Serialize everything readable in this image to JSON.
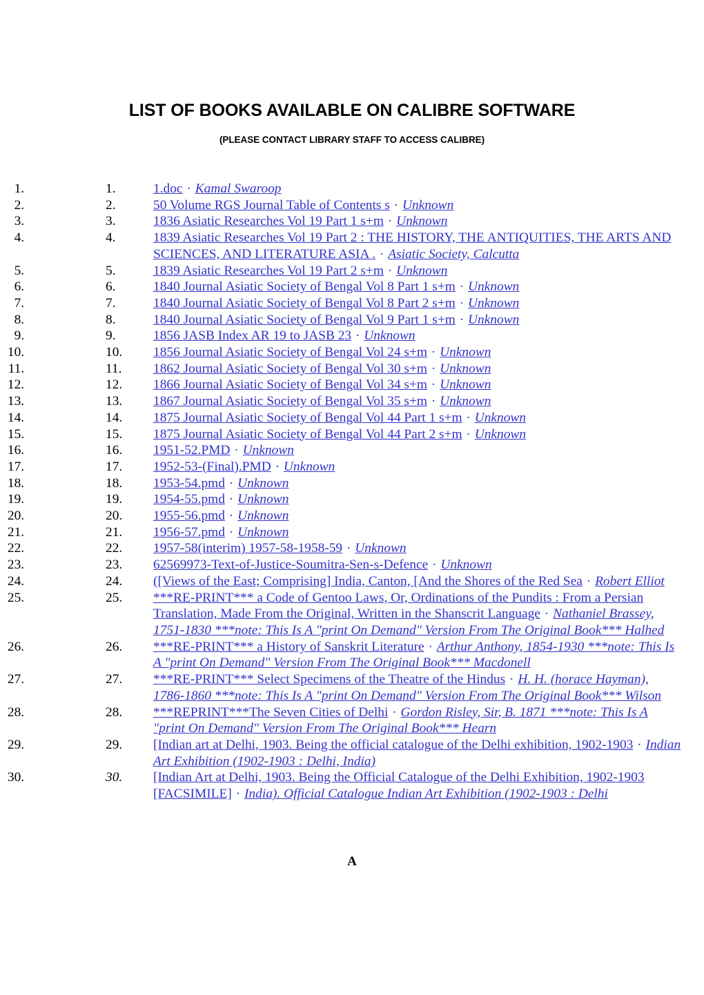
{
  "document": {
    "title": "LIST OF BOOKS AVAILABLE ON CALIBRE SOFTWARE",
    "subtitle": "(PLEASE CONTACT LIBRARY STAFF TO ACCESS CALIBRE)",
    "footer": "A",
    "link_color": "#3333CC",
    "text_color": "#000000",
    "background_color": "#FFFFFF",
    "separator": "·"
  },
  "books": [
    {
      "number": "1.",
      "number_italic": false,
      "title": "1.doc",
      "author": "Kamal Swaroop"
    },
    {
      "number": "2.",
      "number_italic": false,
      "title": "50 Volume RGS Journal Table of Contents s",
      "author": "Unknown"
    },
    {
      "number": "3.",
      "number_italic": false,
      "title": "1836 Asiatic Researches Vol 19 Part 1 s+m",
      "author": "Unknown"
    },
    {
      "number": "4.",
      "number_italic": false,
      "title": "1839 Asiatic Researches Vol 19 Part 2 : THE HISTORY, THE ANTIQUITIES, THE ARTS AND SCIENCES, AND LITERATURE ASIA .",
      "author": "Asiatic Society, Calcutta"
    },
    {
      "number": "5.",
      "number_italic": false,
      "title": "1839 Asiatic Researches Vol 19 Part 2 s+m",
      "author": "Unknown"
    },
    {
      "number": "6.",
      "number_italic": false,
      "title": "1840 Journal Asiatic Society of Bengal Vol 8 Part 1 s+m",
      "author": "Unknown"
    },
    {
      "number": "7.",
      "number_italic": false,
      "title": "1840 Journal Asiatic Society of Bengal Vol 8 Part 2 s+m",
      "author": "Unknown"
    },
    {
      "number": "8.",
      "number_italic": false,
      "title": "1840 Journal Asiatic Society of Bengal Vol 9 Part 1 s+m",
      "author": "Unknown"
    },
    {
      "number": "9.",
      "number_italic": false,
      "title": "1856 JASB Index AR 19 to JASB 23",
      "author": "Unknown"
    },
    {
      "number": "10.",
      "number_italic": false,
      "title": "1856 Journal Asiatic Society of Bengal Vol 24 s+m",
      "author": "Unknown"
    },
    {
      "number": "11.",
      "number_italic": false,
      "title": "1862 Journal Asiatic Society of Bengal Vol 30 s+m",
      "author": "Unknown"
    },
    {
      "number": "12.",
      "number_italic": false,
      "title": "1866 Journal Asiatic Society of Bengal Vol 34 s+m",
      "author": "Unknown"
    },
    {
      "number": "13.",
      "number_italic": false,
      "title": "1867 Journal Asiatic Society of Bengal Vol 35 s+m",
      "author": "Unknown"
    },
    {
      "number": "14.",
      "number_italic": false,
      "title": "1875 Journal Asiatic Society of Bengal Vol 44 Part 1 s+m",
      "author": "Unknown"
    },
    {
      "number": "15.",
      "number_italic": false,
      "title": "1875 Journal Asiatic Society of Bengal Vol 44 Part 2 s+m",
      "author": "Unknown"
    },
    {
      "number": "16.",
      "number_italic": false,
      "title": "1951-52.PMD",
      "author": "Unknown"
    },
    {
      "number": "17.",
      "number_italic": false,
      "title": "1952-53-(Final).PMD",
      "author": "Unknown"
    },
    {
      "number": "18.",
      "number_italic": false,
      "title": "1953-54.pmd",
      "author": "Unknown"
    },
    {
      "number": "19.",
      "number_italic": false,
      "title": "1954-55.pmd",
      "author": "Unknown"
    },
    {
      "number": "20.",
      "number_italic": false,
      "title": "1955-56.pmd",
      "author": "Unknown"
    },
    {
      "number": "21.",
      "number_italic": false,
      "title": "1956-57.pmd",
      "author": "Unknown"
    },
    {
      "number": "22.",
      "number_italic": false,
      "title": "1957-58(interim) 1957-58-1958-59",
      "author": "Unknown"
    },
    {
      "number": "23.",
      "number_italic": false,
      "title": "62569973-Text-of-Justice-Soumitra-Sen-s-Defence",
      "author": "Unknown"
    },
    {
      "number": "24.",
      "number_italic": false,
      "title": "([Views of the East; Comprising] India, Canton, [And the Shores of the Red Sea",
      "author": "Robert Elliot"
    },
    {
      "number": "25.",
      "number_italic": false,
      "title": "***RE-PRINT*** a Code of Gentoo Laws, Or, Ordinations of the Pundits : From a Persian Translation, Made From the Original, Written in the Shanscrit Language",
      "author": "Nathaniel Brassey, 1751-1830 ***note: This Is A \"print On Demand\" Version From The Original Book*** Halhed"
    },
    {
      "number": "26.",
      "number_italic": false,
      "title": "***RE-PRINT*** a History of Sanskrit Literature",
      "author": "Arthur Anthony, 1854-1930 ***note: This Is A \"print On Demand\" Version From The Original Book*** Macdonell"
    },
    {
      "number": "27.",
      "number_italic": false,
      "title": "***RE-PRINT*** Select Specimens of the Theatre of the Hindus",
      "author": "H. H. (horace Hayman), 1786-1860 ***note: This Is A \"print On Demand\" Version From The Original Book*** Wilson"
    },
    {
      "number": "28.",
      "number_italic": false,
      "title": "***REPRINT***The Seven Cities of Delhi",
      "author": "Gordon Risley, Sir, B. 1871 ***note: This Is A \"print On Demand\" Version From The Original Book*** Hearn"
    },
    {
      "number": "29.",
      "number_italic": false,
      "title": "[Indian art at Delhi, 1903. Being the official catalogue of the Delhi exhibition, 1902-1903",
      "author": "Indian Art Exhibition (1902-1903 : Delhi, India)"
    },
    {
      "number": "30.",
      "number_italic": true,
      "title": "[Indian Art at Delhi, 1903. Being the Official Catalogue of the Delhi Exhibition, 1902-1903 [FACSIMILE]",
      "author": "India). Official Catalogue Indian Art Exhibition (1902-1903 : Delhi"
    }
  ]
}
